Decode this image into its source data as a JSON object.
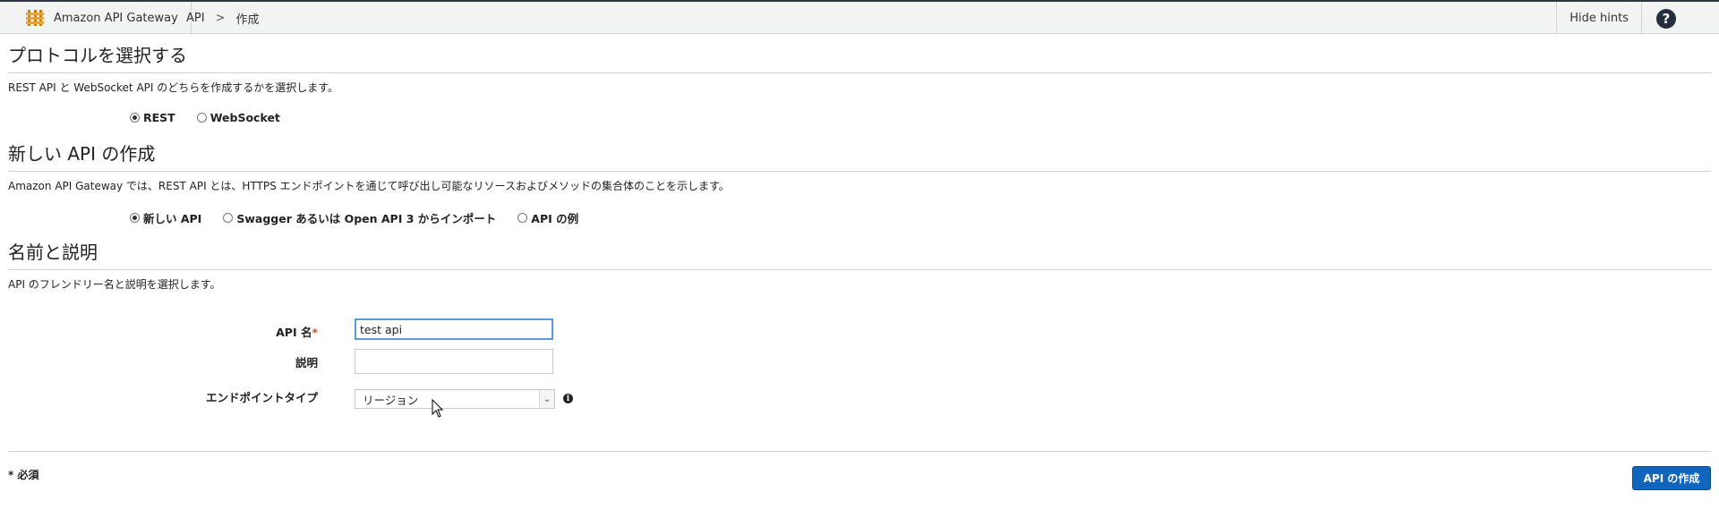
{
  "header": {
    "service_name": "Amazon API Gateway",
    "breadcrumb": [
      "API",
      ">",
      "作成"
    ],
    "hide_hints": "Hide hints",
    "help_symbol": "?"
  },
  "protocol": {
    "title": "プロトコルを選択する",
    "description": "REST API と WebSocket API のどちらを作成するかを選択します。",
    "options": [
      {
        "label": "REST",
        "selected": true
      },
      {
        "label": "WebSocket",
        "selected": false
      }
    ]
  },
  "new_api": {
    "title": "新しい API の作成",
    "description": "Amazon API Gateway では、REST API とは、HTTPS エンドポイントを通じて呼び出し可能なリソースおよびメソッドの集合体のことを示します。",
    "options": [
      {
        "label": "新しい API",
        "selected": true
      },
      {
        "label": "Swagger あるいは Open API 3 からインポート",
        "selected": false
      },
      {
        "label": "API の例",
        "selected": false
      }
    ]
  },
  "name_desc": {
    "title": "名前と説明",
    "description": "API のフレンドリー名と説明を選択します。",
    "api_name_label": "API 名",
    "required_mark": "*",
    "api_name_value": "test api",
    "description_label": "説明",
    "description_value": "",
    "endpoint_type_label": "エンドポイントタイプ",
    "endpoint_type_value": "リージョン",
    "info_symbol": "i"
  },
  "footer": {
    "required_note": "* 必須",
    "create_button": "API の作成"
  },
  "colors": {
    "primary_button": "#1166bb",
    "topbar_bg": "#f2f3f3",
    "focus_border": "#5b9bd5"
  }
}
